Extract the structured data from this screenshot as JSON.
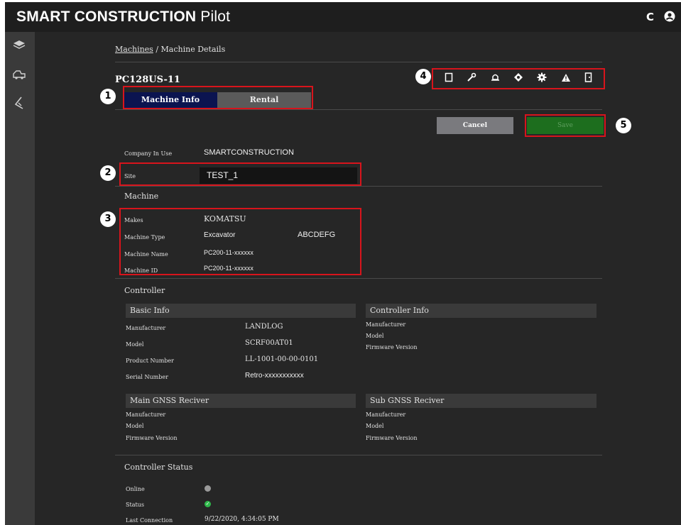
{
  "app": {
    "brand": "SMART CONSTRUCTION",
    "product": "Pilot"
  },
  "topbar": {
    "refresh_icon": "C",
    "account_icon": "account-icon"
  },
  "sidebar": {
    "items": [
      "layers-icon",
      "machines-icon",
      "survey-icon"
    ]
  },
  "breadcrumb": {
    "parent": "Machines",
    "separator": "/",
    "current": "Machine Details"
  },
  "machine": {
    "title": "PC128US-11"
  },
  "tabs": [
    {
      "label": "Machine Info",
      "active": true
    },
    {
      "label": "Rental",
      "active": false
    }
  ],
  "actions": {
    "icons": [
      "tablet-icon",
      "wrench-icon",
      "bell-icon",
      "target-icon",
      "gear-icon",
      "warning-icon",
      "door-icon"
    ],
    "cancel_label": "Cancel",
    "save_label": "Save"
  },
  "markers": {
    "m1": "1",
    "m2": "2",
    "m3": "3",
    "m4": "4",
    "m5": "5"
  },
  "company": {
    "label": "Company In Use",
    "value": "SMARTCONSTRUCTION"
  },
  "site": {
    "label": "Site",
    "value": "TEST_1"
  },
  "machine_section": {
    "heading": "Machine",
    "makes_label": "Makes",
    "makes_value": "KOMATSU",
    "type_label": "Machine Type",
    "type_value": "Excavator",
    "type_extra": "ABCDEFG",
    "name_label": "Machine Name",
    "name_value": "PC200-11-xxxxxx",
    "id_label": "Machine ID",
    "id_value": "PC200-11-xxxxxx"
  },
  "controller": {
    "heading": "Controller",
    "basic_info": {
      "heading": "Basic Info",
      "manufacturer_label": "Manufacturer",
      "manufacturer_value": "LANDLOG",
      "model_label": "Model",
      "model_value": "SCRF00AT01",
      "product_label": "Product Number",
      "product_value": "LL-1001-00-00-0101",
      "serial_label": "Serial Number",
      "serial_value": "Retro-xxxxxxxxxxx"
    },
    "controller_info": {
      "heading": "Controller Info",
      "manufacturer_label": "Manufacturer",
      "model_label": "Model",
      "firmware_label": "Firmware Version"
    },
    "main_gnss": {
      "heading": "Main GNSS Reciver",
      "manufacturer_label": "Manufacturer",
      "model_label": "Model",
      "firmware_label": "Firmware Version"
    },
    "sub_gnss": {
      "heading": "Sub GNSS Reciver",
      "manufacturer_label": "Manufacturer",
      "model_label": "Model",
      "firmware_label": "Firmware Version"
    }
  },
  "status": {
    "heading": "Controller Status",
    "online_label": "Online",
    "status_label": "Status",
    "status_check": "✓",
    "last_label": "Last Connection",
    "last_value": "9/22/2020, 4:34:05 PM"
  },
  "colors": {
    "accent": "#0b1450",
    "save": "#1d6e1e",
    "highlight": "#d8141c"
  }
}
